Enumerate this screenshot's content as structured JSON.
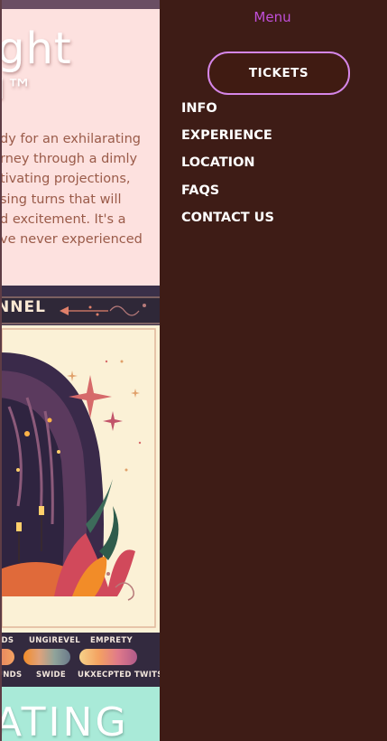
{
  "page": {
    "hero": {
      "title_line1": "ght",
      "title_line2": "l™",
      "paragraph_lines": [
        "dy for an exhilarating",
        "rney through a dimly",
        "tivating projections,",
        "sing turns that will",
        "d excitement. It's a",
        "ve never experienced"
      ]
    },
    "poster": {
      "title": "NNEL",
      "swatch_labels_top": [
        "IDS",
        "UNGIREVEL",
        "EMPRETY"
      ],
      "swatch_labels_bottom": [
        "UNDS",
        "SWIDE",
        "UKXECPTED TWITS"
      ]
    },
    "bottom": {
      "word": "ATING"
    }
  },
  "drawer": {
    "heading": "Menu",
    "tickets_label": "TICKETS",
    "nav_items": [
      {
        "label": "INFO"
      },
      {
        "label": "EXPERIENCE"
      },
      {
        "label": "LOCATION"
      },
      {
        "label": "FAQS"
      },
      {
        "label": "CONTACT US"
      }
    ]
  },
  "colors": {
    "drawer_bg": "#3e1c16",
    "menu_heading": "#c04fd8",
    "tickets_border": "#d586e8",
    "hero_bg": "#fde1df",
    "hero_text": "#9a5b49",
    "poster_bg": "#3a3049",
    "bottom_bg": "#a9ead8"
  }
}
